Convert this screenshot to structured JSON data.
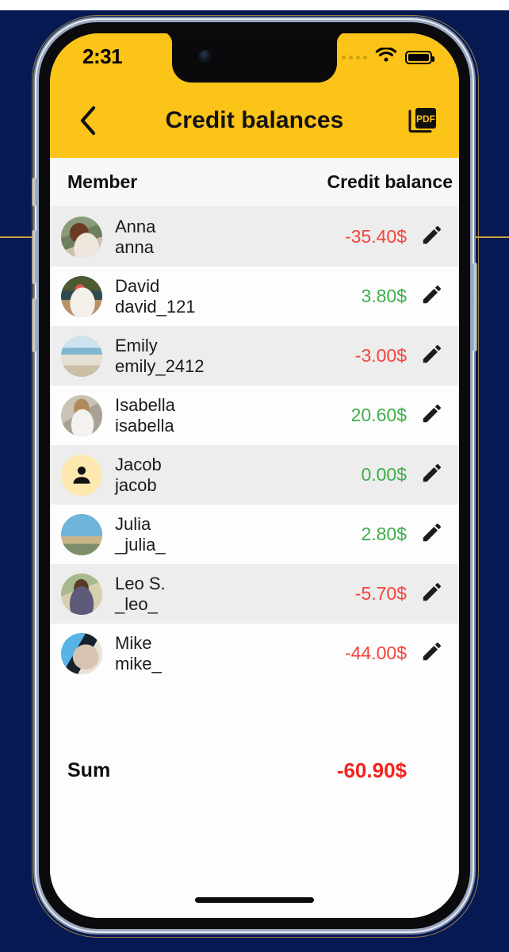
{
  "status_bar": {
    "time": "2:31",
    "signal_icon": "signal-dots-icon",
    "wifi_icon": "wifi-icon",
    "battery_icon": "battery-full-icon"
  },
  "header": {
    "title": "Credit balances",
    "back_icon": "chevron-left-icon",
    "pdf_icon": "pdf-export-icon",
    "pdf_label": "PDF",
    "background_color": "#fcc318"
  },
  "table": {
    "columns": [
      "Member",
      "Credit balance"
    ],
    "rows": [
      {
        "name": "Anna",
        "handle": "anna",
        "amount": "-35.40$",
        "sign": "neg",
        "avatar": "a-anna",
        "edit_icon": "pencil-icon"
      },
      {
        "name": "David",
        "handle": "david_121",
        "amount": "3.80$",
        "sign": "pos",
        "avatar": "a-david",
        "edit_icon": "pencil-icon"
      },
      {
        "name": "Emily",
        "handle": "emily_2412",
        "amount": "-3.00$",
        "sign": "neg",
        "avatar": "a-emily",
        "edit_icon": "pencil-icon"
      },
      {
        "name": "Isabella",
        "handle": "isabella",
        "amount": "20.60$",
        "sign": "pos",
        "avatar": "a-isabella",
        "edit_icon": "pencil-icon"
      },
      {
        "name": "Jacob",
        "handle": "jacob",
        "amount": "0.00$",
        "sign": "pos",
        "avatar": "placeholder",
        "edit_icon": "pencil-icon"
      },
      {
        "name": "Julia",
        "handle": "_julia_",
        "amount": "2.80$",
        "sign": "pos",
        "avatar": "a-julia",
        "edit_icon": "pencil-icon"
      },
      {
        "name": "Leo S.",
        "handle": "_leo_",
        "amount": "-5.70$",
        "sign": "neg",
        "avatar": "a-leo",
        "edit_icon": "pencil-icon"
      },
      {
        "name": "Mike",
        "handle": "mike_",
        "amount": "-44.00$",
        "sign": "neg",
        "avatar": "a-mike",
        "edit_icon": "pencil-icon"
      }
    ]
  },
  "summary": {
    "label": "Sum",
    "value": "-60.90$"
  },
  "colors": {
    "accent_yellow": "#fcc318",
    "negative_red": "#f4433c",
    "positive_green": "#3fae49",
    "sum_red": "#f3231c",
    "row_alt": "#ededed",
    "backdrop_navy": "#071952"
  }
}
